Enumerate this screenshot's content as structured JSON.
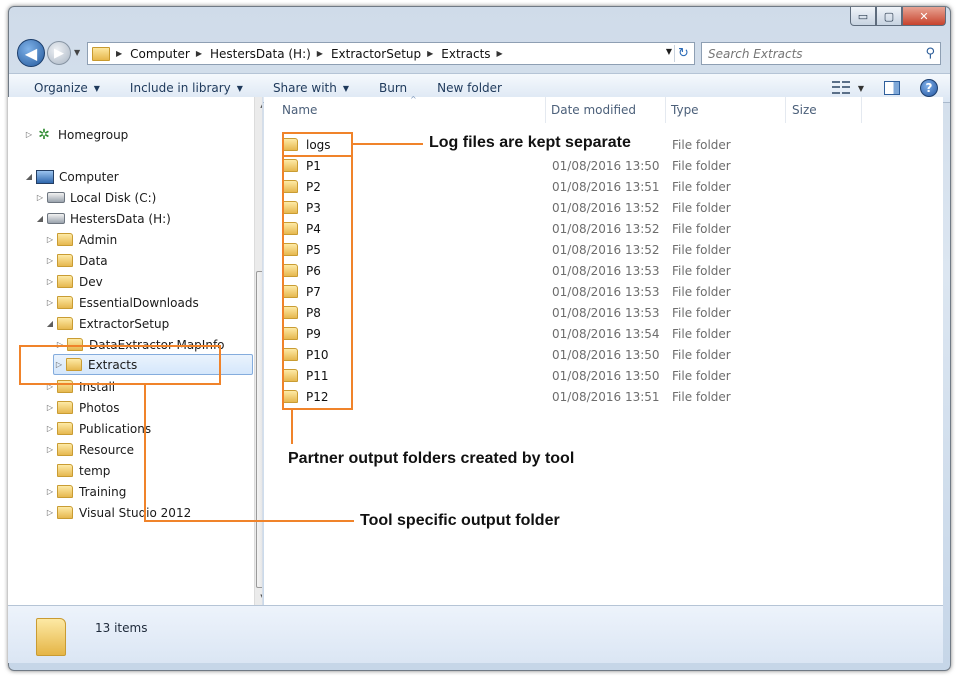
{
  "window": {
    "buttons": {
      "minimize": "▭",
      "maximize": "▢",
      "close": "✕"
    }
  },
  "nav": {
    "breadcrumbs": [
      "Computer",
      "HestersData (H:)",
      "ExtractorSetup",
      "Extracts"
    ],
    "search_placeholder": "Search Extracts"
  },
  "toolbar": {
    "organize": "Organize",
    "include": "Include in library",
    "share": "Share with",
    "burn": "Burn",
    "new_folder": "New folder",
    "help": "?"
  },
  "tree": {
    "homegroup": "Homegroup",
    "computer": "Computer",
    "local_disk": "Local Disk (C:)",
    "hesters": "HestersData (H:)",
    "folders": [
      "Admin",
      "Data",
      "Dev",
      "EssentialDownloads",
      "ExtractorSetup"
    ],
    "sub": [
      "DataExtractor-MapInfo",
      "Extracts"
    ],
    "after": [
      "Install",
      "Photos",
      "Publications",
      "Resource",
      "temp",
      "Training",
      "Visual Studio 2012"
    ]
  },
  "columns": {
    "name": "Name",
    "date": "Date modified",
    "type": "Type",
    "size": "Size"
  },
  "files": [
    {
      "name": "logs",
      "date": "",
      "type": "File folder"
    },
    {
      "name": "P1",
      "date": "01/08/2016 13:50",
      "type": "File folder"
    },
    {
      "name": "P2",
      "date": "01/08/2016 13:51",
      "type": "File folder"
    },
    {
      "name": "P3",
      "date": "01/08/2016 13:52",
      "type": "File folder"
    },
    {
      "name": "P4",
      "date": "01/08/2016 13:52",
      "type": "File folder"
    },
    {
      "name": "P5",
      "date": "01/08/2016 13:52",
      "type": "File folder"
    },
    {
      "name": "P6",
      "date": "01/08/2016 13:53",
      "type": "File folder"
    },
    {
      "name": "P7",
      "date": "01/08/2016 13:53",
      "type": "File folder"
    },
    {
      "name": "P8",
      "date": "01/08/2016 13:53",
      "type": "File folder"
    },
    {
      "name": "P9",
      "date": "01/08/2016 13:54",
      "type": "File folder"
    },
    {
      "name": "P10",
      "date": "01/08/2016 13:50",
      "type": "File folder"
    },
    {
      "name": "P11",
      "date": "01/08/2016 13:50",
      "type": "File folder"
    },
    {
      "name": "P12",
      "date": "01/08/2016 13:51",
      "type": "File folder"
    }
  ],
  "status": {
    "count": "13 items"
  },
  "annotations": {
    "logs": "Log files are kept separate",
    "partners": "Partner output folders created by tool",
    "tool": "Tool specific output folder"
  },
  "colors": {
    "annotation": "#f0832a"
  }
}
